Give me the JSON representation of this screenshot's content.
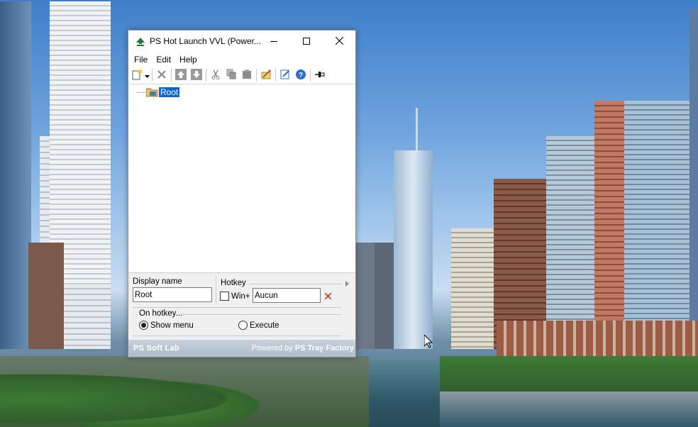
{
  "window": {
    "title": "PS Hot Launch VVL (Power...",
    "controls": [
      "minimize-icon",
      "maximize-icon",
      "close-icon"
    ]
  },
  "menu": {
    "file": "File",
    "edit": "Edit",
    "help": "Help"
  },
  "toolbar": {
    "icons": [
      "new-item-icon",
      "dropdown-arrow-icon",
      "delete-icon",
      "move-up-icon",
      "move-down-icon",
      "cut-icon",
      "copy-icon",
      "paste-icon",
      "wand-icon",
      "edit-icon",
      "help-icon",
      "pin-icon"
    ]
  },
  "tree": {
    "root_label": "Root"
  },
  "props": {
    "display_name_label": "Display name",
    "display_name_value": "Root",
    "hotkey_label": "Hotkey",
    "win_label": "Win+",
    "win_checked": false,
    "hotkey_value": "Aucun",
    "on_hotkey_label": "On hotkey...",
    "show_menu_label": "Show menu",
    "execute_label": "Execute",
    "selected_action": "Show menu"
  },
  "status": {
    "left_brand": "PS Soft Lab",
    "powered_by": "Powered by",
    "right_brand": "PS Tray Factory"
  },
  "colors": {
    "selection": "#0a64d2",
    "statusbar": "#b4c2d0"
  }
}
